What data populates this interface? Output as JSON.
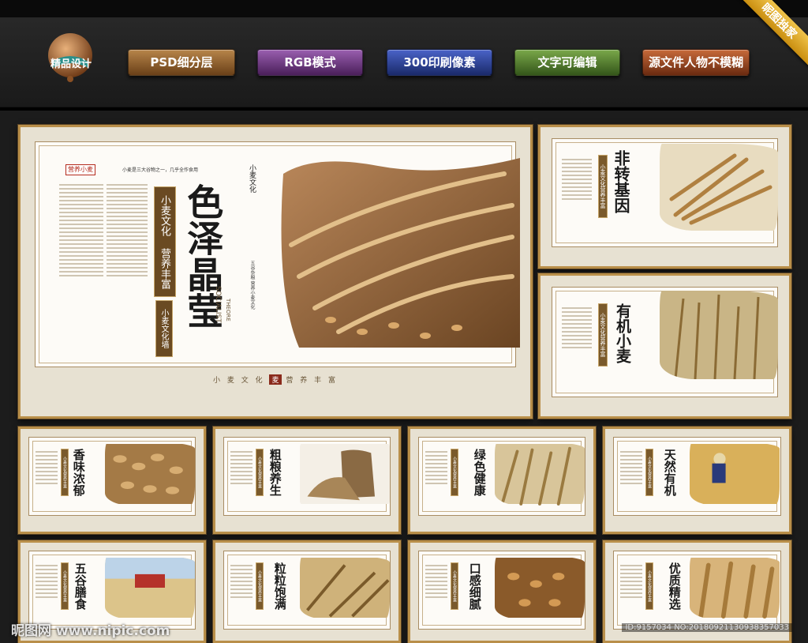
{
  "header": {
    "logo_label": "精品设计",
    "ribbon": "昵图独家",
    "badges": [
      {
        "label": "PSD细分层",
        "color": "#8a5a2a"
      },
      {
        "label": "RGB模式",
        "color": "#6a3a7a"
      },
      {
        "label": "300印刷像素",
        "color": "#2a3f8f"
      },
      {
        "label": "文字可编辑",
        "color": "#4f7a2a"
      },
      {
        "label": "源文件人物不模糊",
        "color": "#9a4a22"
      }
    ]
  },
  "main_board": {
    "tag": "营养小麦",
    "tagline": "小麦是三大谷物之一，几乎全作食用",
    "strip_text": "小麦文化 营养丰富",
    "title": "色泽晶莹",
    "english": "SOCIALIST",
    "english2": "THEORE",
    "small_strip": "小麦文化墙",
    "side_text": "小麦文化",
    "vertical_note": "五谷杂粮 营养小麦文化",
    "bottom_text": "小 麦 文 化",
    "bottom_box": "麦",
    "bottom_text2": "营 养 丰 富"
  },
  "boards": [
    {
      "title": "非转基因"
    },
    {
      "title": "有机小麦"
    },
    {
      "title": "香味浓郁"
    },
    {
      "title": "粗粮养生"
    },
    {
      "title": "绿色健康"
    },
    {
      "title": "天然有机"
    },
    {
      "title": "五谷膳食"
    },
    {
      "title": "粒粒饱满"
    },
    {
      "title": "口感细腻"
    },
    {
      "title": "优质精选"
    }
  ],
  "strip_small": "小麦文化营养丰富",
  "footer": {
    "watermark": "昵图网 www.nipic.com",
    "id": "ID:9157034 NO:20180921130938357033"
  }
}
